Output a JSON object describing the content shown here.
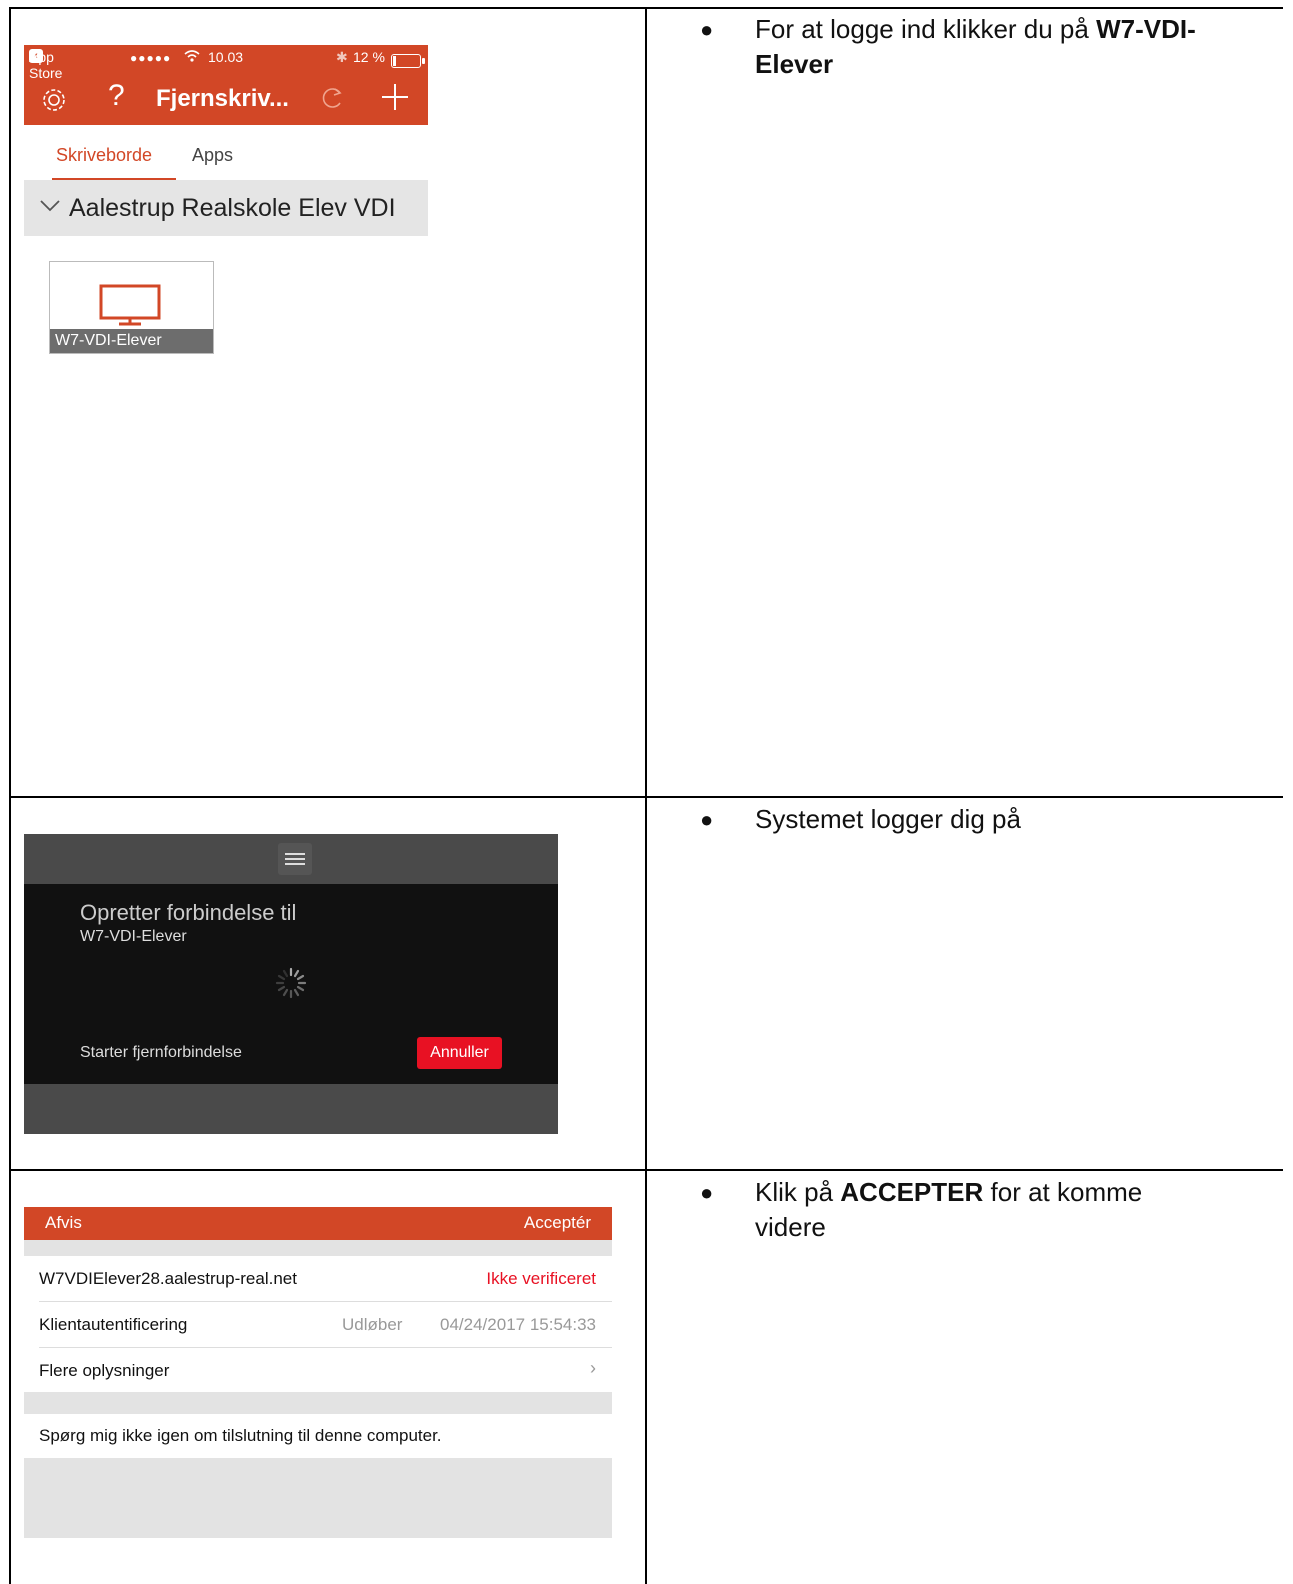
{
  "rows": [
    {
      "note_pre": "For at logge ind klikker du på ",
      "note_bold": "W7-VDI-Elever",
      "note_post": ""
    },
    {
      "note_pre": "Systemet logger dig på",
      "note_bold": "",
      "note_post": ""
    },
    {
      "note_pre": "Klik på ",
      "note_bold": "ACCEPTER",
      "note_post": " for at komme videre"
    }
  ],
  "shot1": {
    "status_app": "App Store",
    "status_signal": "●●●●●",
    "status_time": "10.03",
    "status_bt": "✱",
    "status_battery": "12 %",
    "battery_level": 0.12,
    "toolbar_title": "Fjernskriv...",
    "tab_active": "Skriveborde",
    "tab_other": "Apps",
    "group_title": "Aalestrup Realskole Elev VDI",
    "tile_label": "W7-VDI-Elever",
    "accent_color": "#d24726"
  },
  "shot2": {
    "title": "Opretter forbindelse til",
    "subtitle": "W7-VDI-Elever",
    "status": "Starter fjernforbindelse",
    "cancel_label": "Annuller"
  },
  "shot3": {
    "reject": "Afvis",
    "accept": "Acceptér",
    "host": "W7VDIElever28.aalestrup-real.net",
    "host_status": "Ikke verificeret",
    "auth_label": "Klientautentificering",
    "expires_label": "Udløber",
    "expires_value": "04/24/2017 15:54:33",
    "more_info": "Flere oplysninger",
    "dont_ask": "Spørg mig ikke igen om tilslutning til denne computer."
  }
}
